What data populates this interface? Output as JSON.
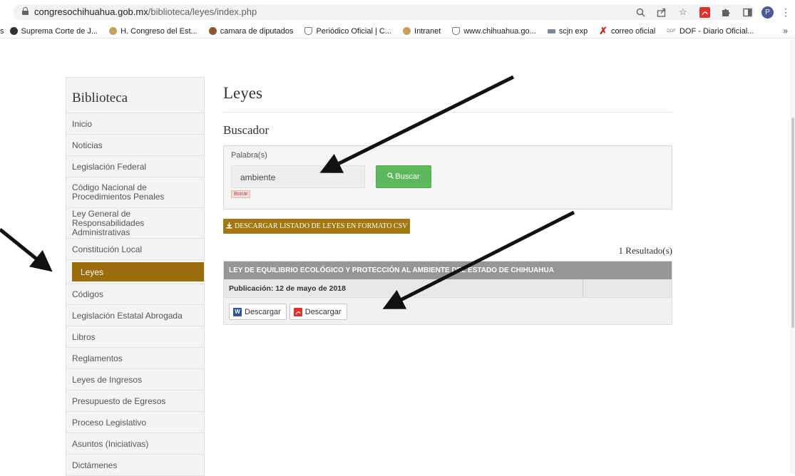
{
  "browser": {
    "url_host": "congresochihuahua.gob.mx",
    "url_path": "/biblioteca/leyes/index.php",
    "avatar_letter": "P",
    "bookmarks": [
      {
        "label": "s",
        "color": ""
      },
      {
        "label": "Suprema Corte de J...",
        "color": "#333333"
      },
      {
        "label": "H. Congreso del Est...",
        "color": "#b58a2a"
      },
      {
        "label": "camara de diputados",
        "color": "#8a5a2a"
      },
      {
        "label": "Periódico Oficial | C...",
        "color": "#888888"
      },
      {
        "label": "Intranet",
        "color": "#b58a2a"
      },
      {
        "label": "www.chihuahua.go...",
        "color": "#888888"
      },
      {
        "label": "scjn exp",
        "color": "#7a8aa0"
      },
      {
        "label": "correo oficial",
        "color": "#d6261c"
      },
      {
        "label": "DOF - Diario Oficial...",
        "color": "#777777"
      }
    ],
    "bookmarks_more": "»"
  },
  "sidebar": {
    "title": "Biblioteca",
    "items": [
      {
        "label": "Inicio",
        "active": false
      },
      {
        "label": "Noticias",
        "active": false
      },
      {
        "label": "Legislación Federal",
        "active": false
      },
      {
        "label": "Código Nacional de\nProcedimientos Penales",
        "active": false
      },
      {
        "label": "Ley General de Responsabilidades\nAdministrativas",
        "active": false
      },
      {
        "label": "Constitución Local",
        "active": false
      },
      {
        "label": "Leyes",
        "active": true
      },
      {
        "label": "Códigos",
        "active": false
      },
      {
        "label": "Legislación Estatal Abrogada",
        "active": false
      },
      {
        "label": "Libros",
        "active": false
      },
      {
        "label": "Reglamentos",
        "active": false
      },
      {
        "label": "Leyes de Ingresos",
        "active": false
      },
      {
        "label": "Presupuesto de Egresos",
        "active": false
      },
      {
        "label": "Proceso Legislativo",
        "active": false
      },
      {
        "label": "Asuntos (Iniciativas)",
        "active": false
      },
      {
        "label": "Dictámenes",
        "active": false
      }
    ]
  },
  "main": {
    "title": "Leyes",
    "subtitle": "Buscador",
    "search": {
      "label": "Palabra(s)",
      "value": "ambiente",
      "button": "Buscar",
      "clear": "Borrar"
    },
    "csv_button": "DESCARGAR LISTADO DE LEYES EN FORMATO CSV",
    "results_count": "1 Resultado(s)",
    "results": [
      {
        "title": "LEY DE EQUILIBRIO ECOLÓGICO Y PROTECCIÓN AL AMBIENTE DEL ESTADO DE CHIHUAHUA",
        "publication": "Publicación: 12 de mayo de 2018",
        "download_word": "Descargar",
        "download_pdf": "Descargar"
      }
    ]
  },
  "colors": {
    "accent_gold": "#9a6c0b",
    "search_green": "#5cb85c",
    "result_header": "#969696"
  }
}
